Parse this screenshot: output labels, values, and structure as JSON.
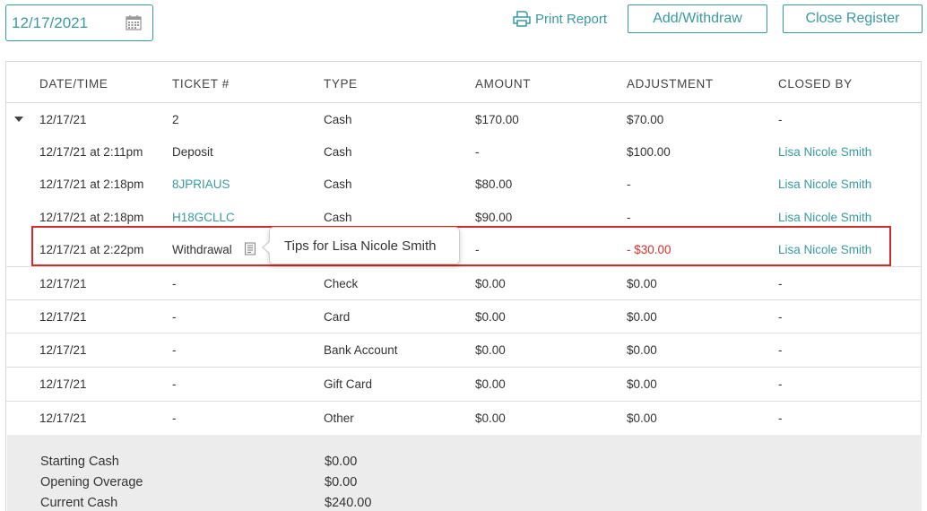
{
  "toolbar": {
    "date_value": "12/17/2021",
    "print_report_label": "Print Report",
    "add_withdraw_label": "Add/Withdraw",
    "close_register_label": "Close Register"
  },
  "table": {
    "headers": [
      "DATE/TIME",
      "TICKET #",
      "TYPE",
      "AMOUNT",
      "ADJUSTMENT",
      "CLOSED BY"
    ],
    "rows": [
      {
        "date": "12/17/21",
        "ticket": "2",
        "type": "Cash",
        "amount": "$170.00",
        "adjustment": "$70.00",
        "closed_by": "-"
      },
      {
        "date": "12/17/21 at 2:11pm",
        "ticket": "Deposit",
        "type": "Cash",
        "amount": "-",
        "adjustment": "$100.00",
        "closed_by": "Lisa Nicole Smith"
      },
      {
        "date": "12/17/21 at 2:18pm",
        "ticket": "8JPRIAUS",
        "type": "Cash",
        "amount": "$80.00",
        "adjustment": "-",
        "closed_by": "Lisa Nicole Smith"
      },
      {
        "date": "12/17/21 at 2:18pm",
        "ticket": "H18GCLLC",
        "type": "Cash",
        "amount": "$90.00",
        "adjustment": "-",
        "closed_by": "Lisa Nicole Smith"
      },
      {
        "date": "12/17/21 at 2:22pm",
        "ticket": "Withdrawal",
        "type": "",
        "amount": "-",
        "adjustment": "- $30.00",
        "closed_by": "Lisa Nicole Smith"
      },
      {
        "date": "12/17/21",
        "ticket": "-",
        "type": "Check",
        "amount": "$0.00",
        "adjustment": "$0.00",
        "closed_by": "-"
      },
      {
        "date": "12/17/21",
        "ticket": "-",
        "type": "Card",
        "amount": "$0.00",
        "adjustment": "$0.00",
        "closed_by": "-"
      },
      {
        "date": "12/17/21",
        "ticket": "-",
        "type": "Bank Account",
        "amount": "$0.00",
        "adjustment": "$0.00",
        "closed_by": "-"
      },
      {
        "date": "12/17/21",
        "ticket": "-",
        "type": "Gift Card",
        "amount": "$0.00",
        "adjustment": "$0.00",
        "closed_by": "-"
      },
      {
        "date": "12/17/21",
        "ticket": "-",
        "type": "Other",
        "amount": "$0.00",
        "adjustment": "$0.00",
        "closed_by": "-"
      }
    ]
  },
  "tooltip": {
    "text": "Tips for Lisa Nicole Smith"
  },
  "summary": {
    "items": [
      {
        "label": "Starting Cash",
        "value": "$0.00"
      },
      {
        "label": "Opening Overage",
        "value": "$0.00"
      },
      {
        "label": "Current Cash",
        "value": "$240.00"
      }
    ]
  },
  "colors": {
    "accent": "#3a9aa0",
    "negative": "#d4302c",
    "highlight": "#d42a2a"
  }
}
